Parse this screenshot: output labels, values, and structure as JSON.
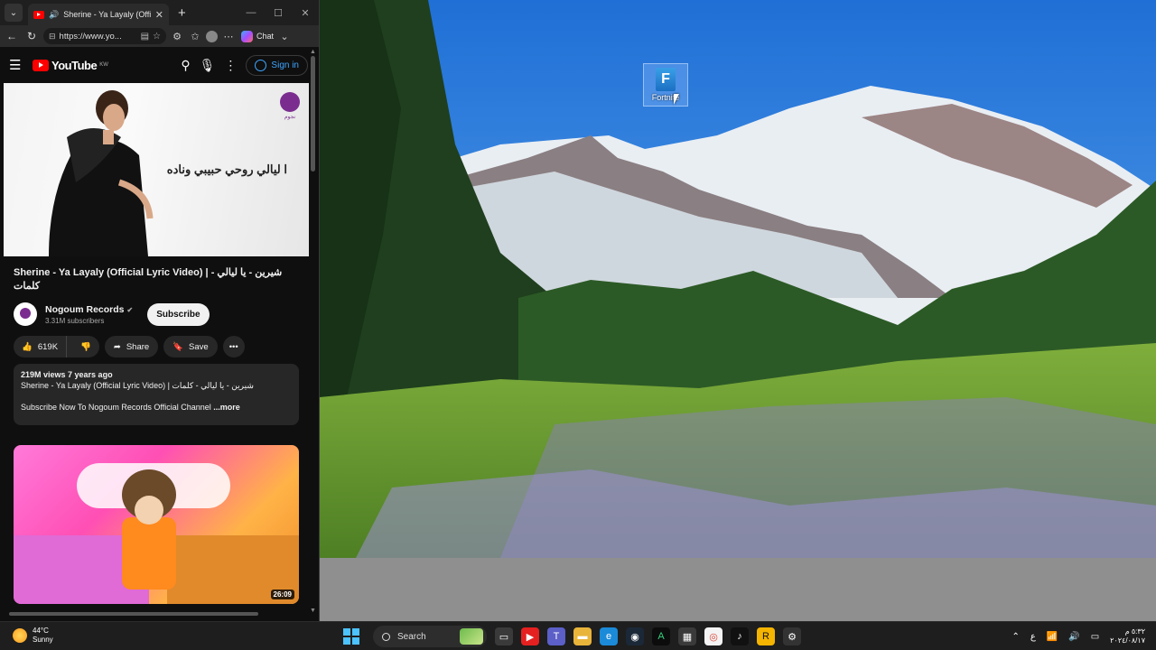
{
  "browser": {
    "tab_title": "Sherine - Ya Layaly (Official Ly",
    "url": "https://www.yo...",
    "chat_label": "Chat"
  },
  "youtube": {
    "logo_text": "YouTube",
    "country_code": "KW",
    "signin_label": "Sign in",
    "player_lyric": "ا ليالي روحي حبيبي وناده",
    "player_channel_tag": "نجوم",
    "video_title": "Sherine - Ya Layaly (Official Lyric Video) | شيرين - يا ليالي - كلمات",
    "channel_name": "Nogoum Records",
    "subscribers": "3.31M subscribers",
    "subscribe_label": "Subscribe",
    "likes": "619K",
    "share_label": "Share",
    "save_label": "Save",
    "description": {
      "meta": "219M views  7 years ago",
      "line2": "Sherine - Ya Layaly (Official Lyric Video) | شيرين - يا ليالي - كلمات",
      "line3": "Subscribe Now To Nogoum Records Official Channel",
      "more": "...more"
    },
    "recommended": {
      "duration": "26:09"
    }
  },
  "desktop": {
    "icon_label": "Fortnite",
    "icon_letter": "F"
  },
  "taskbar": {
    "weather_temp": "44°C",
    "weather_desc": "Sunny",
    "search_placeholder": "Search",
    "tray_lang": "ع",
    "clock_time": "٥:٣٢ م",
    "clock_date": "٢٠٢٤/٠٨/١٧"
  }
}
